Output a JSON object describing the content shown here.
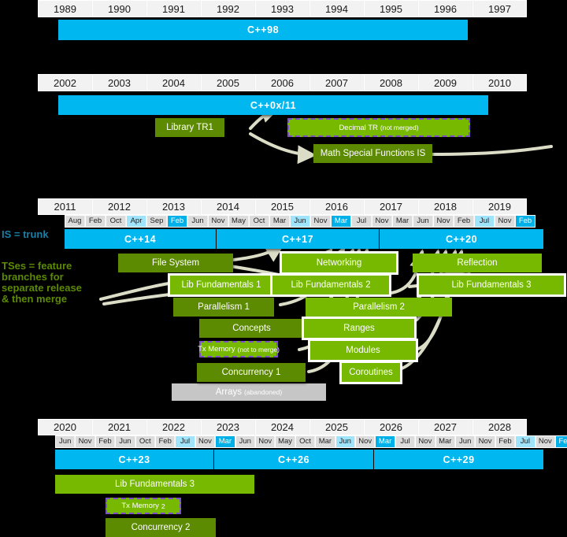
{
  "notes": {
    "is_trunk": "IS = trunk",
    "ts_branches": "TSes = feature\nbranches for\nseparate release\n& then merge"
  },
  "sections": [
    {
      "id": "s1",
      "years": [
        "1989",
        "1990",
        "1991",
        "1992",
        "1993",
        "1994",
        "1995",
        "1996",
        "1997"
      ],
      "months": [],
      "standards": [
        {
          "label": "C++98"
        }
      ],
      "features": []
    },
    {
      "id": "s2",
      "years": [
        "2002",
        "2003",
        "2004",
        "2005",
        "2006",
        "2007",
        "2008",
        "2009",
        "2010"
      ],
      "months": [],
      "standards": [
        {
          "label": "C++0x/11"
        }
      ],
      "features": [
        {
          "label": "Library TR1",
          "style": "dark"
        },
        {
          "label": "Decimal TR",
          "sub": "(not merged)",
          "style": "dashed"
        },
        {
          "label": "Math Special Functions IS",
          "style": "dark"
        }
      ]
    },
    {
      "id": "s3",
      "years": [
        "2011",
        "2012",
        "2013",
        "2014",
        "2015",
        "2016",
        "2017",
        "2018",
        "2019"
      ],
      "months": [
        {
          "label": "Aug",
          "hl": "none"
        },
        {
          "label": "Feb",
          "hl": "none"
        },
        {
          "label": "Oct",
          "hl": "none"
        },
        {
          "label": "Apr",
          "hl": "light"
        },
        {
          "label": "Sep",
          "hl": "none"
        },
        {
          "label": "Feb",
          "hl": "dark"
        },
        {
          "label": "Jun",
          "hl": "none"
        },
        {
          "label": "Nov",
          "hl": "none"
        },
        {
          "label": "May",
          "hl": "none"
        },
        {
          "label": "Oct",
          "hl": "none"
        },
        {
          "label": "Mar",
          "hl": "none"
        },
        {
          "label": "Jun",
          "hl": "light"
        },
        {
          "label": "Nov",
          "hl": "none"
        },
        {
          "label": "Mar",
          "hl": "dark"
        },
        {
          "label": "Jul",
          "hl": "none"
        },
        {
          "label": "Nov",
          "hl": "none"
        },
        {
          "label": "Mar",
          "hl": "none"
        },
        {
          "label": "Jun",
          "hl": "none"
        },
        {
          "label": "Nov",
          "hl": "none"
        },
        {
          "label": "Feb",
          "hl": "none"
        },
        {
          "label": "Jul",
          "hl": "light"
        },
        {
          "label": "Nov",
          "hl": "none"
        },
        {
          "label": "Feb",
          "hl": "dark"
        }
      ],
      "standards": [
        {
          "label": "C++14"
        },
        {
          "label": "C++17"
        },
        {
          "label": "C++20"
        }
      ],
      "features": [
        {
          "label": "File System",
          "style": "dark"
        },
        {
          "label": "Networking",
          "style": "bright-outline"
        },
        {
          "label": "Reflection",
          "style": "bright"
        },
        {
          "label": "Lib Fundamentals 1",
          "style": "bright-outline"
        },
        {
          "label": "Lib Fundamentals 2",
          "style": "bright-outline"
        },
        {
          "label": "Lib Fundamentals 3",
          "style": "bright-outline"
        },
        {
          "label": "Parallelism 1",
          "style": "dark"
        },
        {
          "label": "Parallelism 2",
          "style": "bright"
        },
        {
          "label": "Concepts",
          "style": "dark"
        },
        {
          "label": "Ranges",
          "style": "bright-outline"
        },
        {
          "label": "Tx Memory",
          "sub": "(not to merge)",
          "style": "dashed"
        },
        {
          "label": "Modules",
          "style": "bright-outline"
        },
        {
          "label": "Concurrency 1",
          "style": "dark"
        },
        {
          "label": "Coroutines",
          "style": "bright-outline"
        },
        {
          "label": "Arrays",
          "sub": "(abandoned)",
          "style": "gray"
        }
      ]
    },
    {
      "id": "s4",
      "years": [
        "2020",
        "2021",
        "2022",
        "2023",
        "2024",
        "2025",
        "2026",
        "2027",
        "2028"
      ],
      "months": [
        {
          "label": "Jun",
          "hl": "none"
        },
        {
          "label": "Nov",
          "hl": "none"
        },
        {
          "label": "Feb",
          "hl": "none"
        },
        {
          "label": "Jun",
          "hl": "none"
        },
        {
          "label": "Oct",
          "hl": "none"
        },
        {
          "label": "Feb",
          "hl": "none"
        },
        {
          "label": "Jul",
          "hl": "light"
        },
        {
          "label": "Nov",
          "hl": "none"
        },
        {
          "label": "Mar",
          "hl": "dark"
        },
        {
          "label": "Jun",
          "hl": "none"
        },
        {
          "label": "Nov",
          "hl": "none"
        },
        {
          "label": "May",
          "hl": "none"
        },
        {
          "label": "Oct",
          "hl": "none"
        },
        {
          "label": "Mar",
          "hl": "none"
        },
        {
          "label": "Jun",
          "hl": "light"
        },
        {
          "label": "Nov",
          "hl": "none"
        },
        {
          "label": "Mar",
          "hl": "dark"
        },
        {
          "label": "Jul",
          "hl": "none"
        },
        {
          "label": "Nov",
          "hl": "none"
        },
        {
          "label": "Mar",
          "hl": "none"
        },
        {
          "label": "Jun",
          "hl": "none"
        },
        {
          "label": "Nov",
          "hl": "none"
        },
        {
          "label": "Feb",
          "hl": "none"
        },
        {
          "label": "Jul",
          "hl": "light"
        },
        {
          "label": "Nov",
          "hl": "none"
        },
        {
          "label": "Feb",
          "hl": "dark"
        }
      ],
      "standards": [
        {
          "label": "C++23"
        },
        {
          "label": "C++26"
        },
        {
          "label": "C++29"
        }
      ],
      "features": [
        {
          "label": "Lib Fundamentals 3",
          "style": "bright"
        },
        {
          "label": "Tx Memory",
          "sub": "2",
          "style": "dashed"
        },
        {
          "label": "Concurrency 2",
          "style": "dark"
        }
      ]
    }
  ],
  "colors": {
    "standard_blue": "#00b7ef",
    "ts_dark_green": "#5c8a00",
    "ts_bright_green": "#76b900",
    "abandoned_gray": "#c6c6c6",
    "dashed_purple": "#7b4fc9",
    "month_highlight_light": "#9fe4fb",
    "month_highlight_dark": "#00b0e8",
    "background": "#000000"
  }
}
